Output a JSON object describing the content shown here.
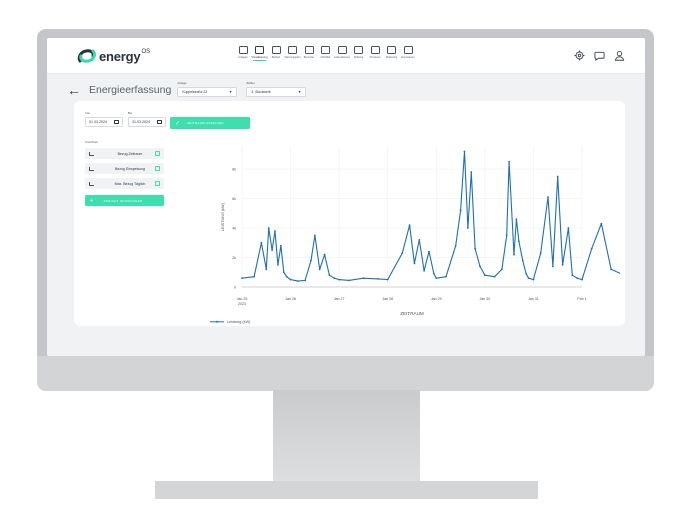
{
  "app": {
    "logo_text": "energy",
    "logo_sup": "OS"
  },
  "nav": [
    {
      "label": "Anlagen",
      "icon": "plant-icon",
      "active": false
    },
    {
      "label": "Visualisierung",
      "icon": "monitor-icon",
      "active": true
    },
    {
      "label": "Betrieb",
      "icon": "factory-icon",
      "active": false
    },
    {
      "label": "Wartungsplan",
      "icon": "wrench-icon",
      "active": false
    },
    {
      "label": "Benutzer",
      "icon": "user-icon",
      "active": false
    },
    {
      "label": "Mobilität",
      "icon": "car-icon",
      "active": false
    },
    {
      "label": "Ladestationen",
      "icon": "charger-icon",
      "active": false
    },
    {
      "label": "Zählung",
      "icon": "building-icon",
      "active": false
    },
    {
      "label": "Prozesse",
      "icon": "box-icon",
      "active": false
    },
    {
      "label": "Marketing",
      "icon": "megaphone-icon",
      "active": false
    },
    {
      "label": "Exportieren",
      "icon": "export-icon",
      "active": false
    }
  ],
  "top_icons": [
    "settings-icon",
    "chat-icon",
    "profile-icon"
  ],
  "page": {
    "title": "Energieerfassung",
    "anlage_label": "Anlage",
    "anlage_value": "Kuppelstraße 22",
    "zaehler_label": "Zähler",
    "zaehler_value": "3. Stockwerk"
  },
  "filters": {
    "von_label": "Von",
    "von_value": "01.03.2024",
    "bis_label": "Bis",
    "bis_value": "31.03.2024",
    "apply_label": "ZEITRAUM ANZEIGEN"
  },
  "views": {
    "label": "Ansichten",
    "items": [
      "Bezug Zeitraum",
      "Bezug Einspeisung",
      "Max. Bezug Täglich"
    ],
    "add_label": "ANSICHT HINZUFÜGEN"
  },
  "chart_data": {
    "type": "line",
    "xlabel": "ZEITRAUM",
    "ylabel": "LEISTUNG (kW)",
    "x_ticks": [
      "Jan 25",
      "Jan 26",
      "Jan 27",
      "Jan 28",
      "Jan 29",
      "Jan 30",
      "Jan 31",
      "Feb 1"
    ],
    "x_tick_year": "2023",
    "y_ticks": [
      "0",
      "2k",
      "4k",
      "6k",
      "8k"
    ],
    "ylim": [
      0,
      9500
    ],
    "grid": true,
    "legend": "bottom-left",
    "line_color": "#1f6fb2",
    "series": [
      {
        "name": "Leistung (kW)",
        "x_days": [
          0.0,
          0.25,
          0.4,
          0.5,
          0.55,
          0.62,
          0.68,
          0.74,
          0.8,
          0.86,
          0.92,
          1.0,
          1.15,
          1.3,
          1.42,
          1.5,
          1.6,
          1.7,
          1.8,
          1.9,
          2.0,
          2.2,
          2.5,
          2.8,
          3.0,
          3.3,
          3.45,
          3.55,
          3.65,
          3.75,
          3.85,
          3.95,
          4.0,
          4.2,
          4.4,
          4.5,
          4.58,
          4.65,
          4.72,
          4.8,
          4.9,
          5.0,
          5.2,
          5.35,
          5.45,
          5.5,
          5.6,
          5.65,
          5.7,
          5.78,
          5.85,
          5.9,
          6.0,
          6.15,
          6.3,
          6.4,
          6.5,
          6.6,
          6.72,
          6.8,
          6.9,
          7.0,
          7.2,
          7.4,
          7.6,
          7.8,
          8.0
        ],
        "values": [
          600,
          700,
          3000,
          1200,
          4000,
          2500,
          3800,
          1500,
          2800,
          1000,
          700,
          500,
          400,
          450,
          1800,
          3500,
          1200,
          2200,
          800,
          600,
          500,
          450,
          600,
          550,
          500,
          2300,
          4200,
          1600,
          3200,
          1100,
          2400,
          900,
          600,
          700,
          2800,
          5200,
          9200,
          4000,
          7800,
          2600,
          1400,
          800,
          700,
          1200,
          3500,
          8500,
          2200,
          4600,
          3100,
          1800,
          900,
          600,
          500,
          2300,
          6100,
          1400,
          7500,
          1500,
          4000,
          800,
          600,
          500,
          2600,
          4300,
          1200,
          900,
          600
        ]
      }
    ]
  }
}
